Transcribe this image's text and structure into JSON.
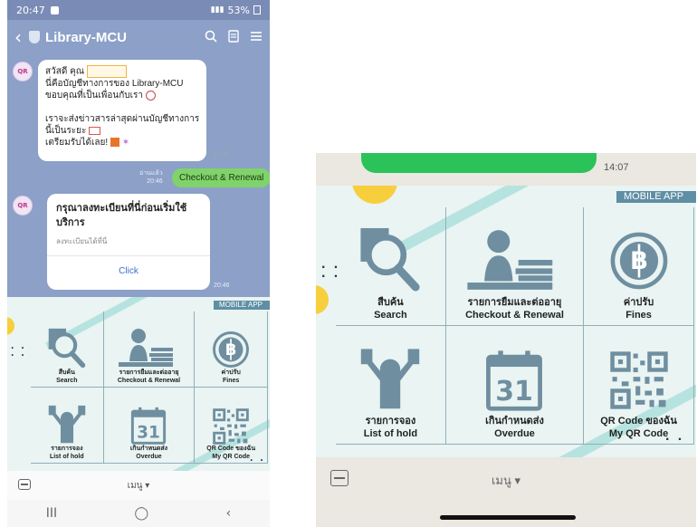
{
  "left": {
    "status": {
      "time": "20:47",
      "battery": "53%"
    },
    "header": {
      "title": "Library-MCU",
      "back_icon": "chevron-left-icon",
      "search_icon": "search-icon",
      "notes_icon": "notes-icon",
      "menu_icon": "hamburger-menu-icon"
    },
    "msg1": {
      "greeting": "สวัสดี คุณ",
      "line2": "นี่คือบัญชีทางการของ Library-MCU",
      "line3": "ขอบคุณที่เป็นเพื่อนกับเรา",
      "line4": "เราจะส่งข่าวสารล่าสุดผ่านบัญชีทางการ",
      "line5": "นี้เป็นระยะ",
      "line6": "เตรียมรับได้เลย!",
      "time": "20:46"
    },
    "sent": {
      "text": "Checkout & Renewal",
      "read": "อ่านแล้ว",
      "time": "20:46"
    },
    "msg2": {
      "title": "กรุณาลงทะเบียนที่นี่ก่อนเริ่มใช้บริการ",
      "subtitle": "ลงทะเบียนได้ที่นี่",
      "action": "Click",
      "time": "20:46"
    },
    "menu_label": "เมนู ▾",
    "nav": {
      "recent": "III",
      "home": "◯",
      "back": "‹"
    }
  },
  "richmenu": {
    "badge": "MOBILE APP",
    "items": [
      {
        "th": "สืบค้น",
        "en": "Search",
        "icon": "search-book-icon"
      },
      {
        "th": "รายการยืมและต่ออายุ",
        "en": "Checkout & Renewal",
        "icon": "person-books-icon"
      },
      {
        "th": "ค่าปรับ",
        "en": "Fines",
        "icon": "baht-coin-icon"
      },
      {
        "th": "รายการจอง",
        "en": "List of hold",
        "icon": "person-raising-books-icon"
      },
      {
        "th": "เกินกำหนดส่ง",
        "en": "Overdue",
        "icon": "calendar-31-icon",
        "number": "31"
      },
      {
        "th": "QR Code ของฉัน",
        "en": "My QR Code",
        "icon": "qr-code-icon"
      }
    ]
  },
  "right": {
    "time": "14:07",
    "menu_label": "เมนู ▾"
  },
  "colors": {
    "chat_bg": "#8ca0c8",
    "sent_bubble": "#7fd36a",
    "icon_blue": "#6f8fa0",
    "badge": "#5f8fa4",
    "accent_yellow": "#f7cf3c"
  }
}
